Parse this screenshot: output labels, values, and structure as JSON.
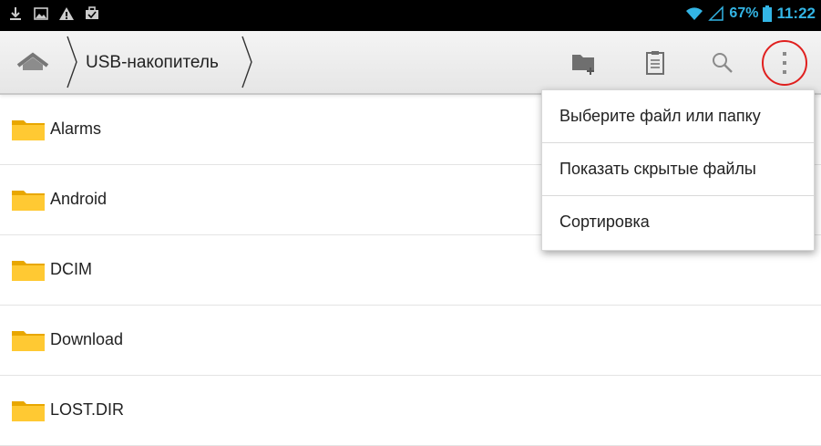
{
  "statusbar": {
    "left_icons": [
      "download-icon",
      "image-icon",
      "warning-icon",
      "briefcase-icon"
    ],
    "battery_percent": "67%",
    "time": "11:22",
    "accent_color": "#33b5e5"
  },
  "actionbar": {
    "path": "USB-накопитель",
    "icons": [
      "home-icon",
      "new-folder-icon",
      "clipboard-icon",
      "search-icon",
      "overflow-menu-icon"
    ]
  },
  "files": [
    {
      "name": "Alarms",
      "icon": "folder-icon"
    },
    {
      "name": "Android",
      "icon": "folder-icon"
    },
    {
      "name": "DCIM",
      "icon": "folder-icon"
    },
    {
      "name": "Download",
      "icon": "folder-icon"
    },
    {
      "name": "LOST.DIR",
      "icon": "folder-icon"
    }
  ],
  "menu": {
    "items": [
      {
        "label": "Выберите файл или папку"
      },
      {
        "label": "Показать скрытые файлы"
      },
      {
        "label": "Сортировка"
      }
    ]
  },
  "highlight_color": "#e0201f"
}
